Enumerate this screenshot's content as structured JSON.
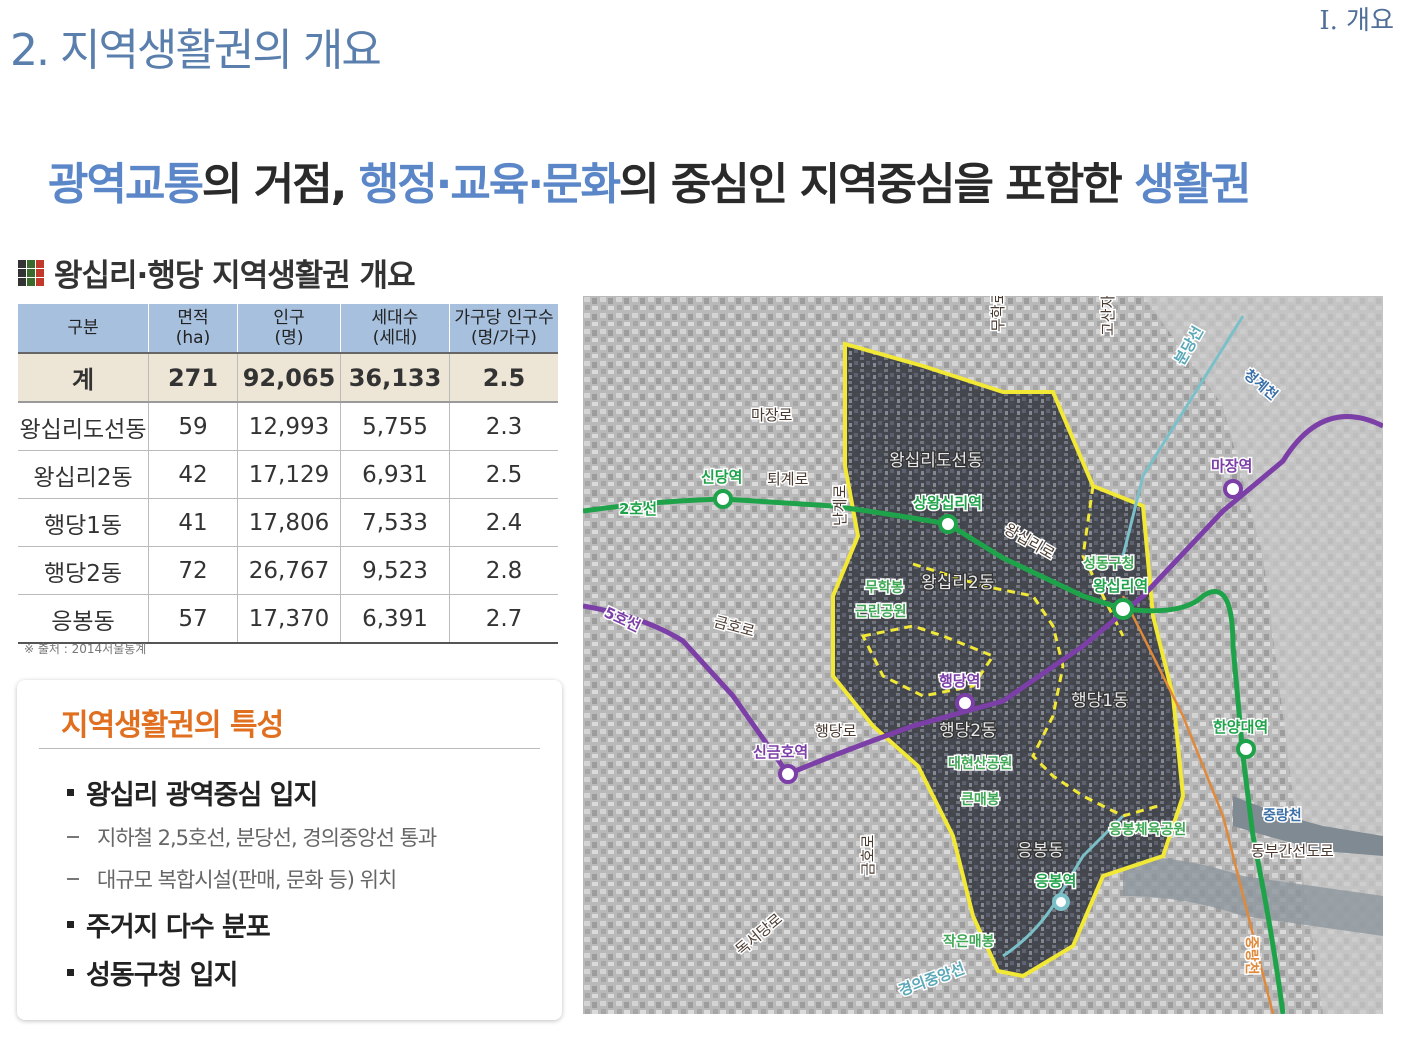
{
  "header": {
    "section_title": "2. 지역생활권의 개요",
    "chapter_label": "Ⅰ. 개요"
  },
  "headline": {
    "parts": [
      "광역교통",
      "의 거점, ",
      "행정·교육·문화",
      "의 중심인 지역중심을 포함한 ",
      "생활권"
    ],
    "highlight_color": "#5b87c9"
  },
  "subtitle": "왕십리·행당 지역생활권 개요",
  "icon_colors": [
    "#333333",
    "#3a6b2d",
    "#c0392b"
  ],
  "table": {
    "headers": [
      "구분",
      "면적\n(ha)",
      "인구\n(명)",
      "세대수\n(세대)",
      "가구당 인구수\n(명/가구)"
    ],
    "total_row": [
      "계",
      "271",
      "92,065",
      "36,133",
      "2.5"
    ],
    "rows": [
      [
        "왕십리도선동",
        "59",
        "12,993",
        "5,755",
        "2.3"
      ],
      [
        "왕십리2동",
        "42",
        "17,129",
        "6,931",
        "2.5"
      ],
      [
        "행당1동",
        "41",
        "17,806",
        "7,533",
        "2.4"
      ],
      [
        "행당2동",
        "72",
        "26,767",
        "9,523",
        "2.8"
      ],
      [
        "응봉동",
        "57",
        "17,370",
        "6,391",
        "2.7"
      ]
    ],
    "source": "※ 출처 : 2014서울통계"
  },
  "features": {
    "title": "지역생활권의 특성",
    "items": [
      {
        "type": "main",
        "text": "왕십리 광역중심 입지"
      },
      {
        "type": "sub",
        "text": "지하철 2,5호선, 분당선, 경의중앙선 통과"
      },
      {
        "type": "sub",
        "text": "대규모 복합시설(판매, 문화 등) 위치"
      },
      {
        "type": "main",
        "text": "주거지 다수 분포"
      },
      {
        "type": "main",
        "text": "성동구청 입지"
      }
    ]
  },
  "map": {
    "stations": {
      "sindang": "신당역",
      "sangwangsimni": "상왕십리역",
      "wangsimni": "왕십리역",
      "majang": "마장역",
      "haengdang": "행당역",
      "singeumho": "신금호역",
      "hanyang": "한양대역",
      "eungbong": "응봉역"
    },
    "lines": {
      "line2": "2호선",
      "line5": "5호선",
      "bundang": "분당선",
      "gyeongui": "경의중앙선"
    },
    "roads": {
      "majangro": "마장로",
      "toegyero": "퇴계로",
      "wangsimniro": "왕십리로",
      "muhakro": "무학로",
      "gosanjaro": "고산자로",
      "nangyero": "난계로",
      "geumhoro": "금호로",
      "haengdangro": "행당로",
      "dokseodangro": "독서당로",
      "geumhoro2": "금호로",
      "dongbu": "동부간선도로"
    },
    "districts": {
      "doseon": "왕십리도선동",
      "w2": "왕십리2동",
      "h1": "행당1동",
      "h2": "행당2동",
      "eungbong": "응봉동"
    },
    "landmarks": {
      "muhakbong": "무학봉\n근린공원",
      "daehyeonsan": "대현산공원",
      "eungbong_park": "응봉체육공원",
      "seongdong_office": "성동구청",
      "cheonggyecheon": "청계천",
      "jungnangcheon": "중랑천",
      "eunmaebong": "큰매봉",
      "jageunmaebong": "작은매봉",
      "jungnang_v": "중랑천"
    },
    "colors": {
      "line2": "#1fa34a",
      "line5": "#7b3fa7",
      "boundary": "#f2e836",
      "bundang": "#f0b020",
      "gyeongui": "#7bc0c8"
    }
  }
}
